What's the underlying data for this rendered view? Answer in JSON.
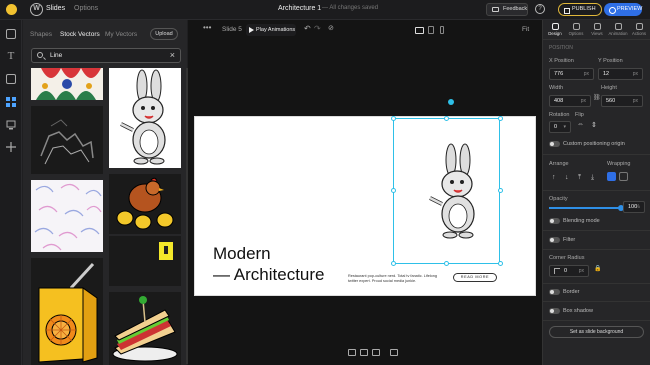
{
  "topbar": {
    "tabs": [
      {
        "label": "Slides"
      },
      {
        "label": "Options"
      }
    ],
    "title": "Architecture 1",
    "status": "— All changes saved",
    "feedback": "Feedback",
    "help": "?",
    "publish": "PUBLISH",
    "preview": "PREVIEW"
  },
  "assets": {
    "tabs": [
      {
        "label": "Shapes"
      },
      {
        "label": "Stock Vectors"
      },
      {
        "label": "My Vectors"
      }
    ],
    "upload": "Upload",
    "search": {
      "value": "Line"
    }
  },
  "canvas": {
    "slide_label": "Slide 5",
    "play_label": "Play Animations",
    "fit_label": "Fit",
    "slide": {
      "title_line1": "Modern",
      "title_line2": "— Architecture",
      "body": "Restaurant pop-culture nerd. Total tv fanatic. Lifelong twitter expert. Proud social media junkie.",
      "button": "READ MORE"
    }
  },
  "inspector": {
    "tabs": [
      {
        "label": "Design"
      },
      {
        "label": "Options"
      },
      {
        "label": "Views"
      },
      {
        "label": "Animation"
      },
      {
        "label": "Actions"
      }
    ],
    "section": "POSITION",
    "x_label": "X Position",
    "x_value": "776",
    "x_unit": "px",
    "y_label": "Y Position",
    "y_value": "12",
    "y_unit": "px",
    "width_label": "Width",
    "width_value": "408",
    "width_unit": "px",
    "height_label": "Height",
    "height_value": "560",
    "height_unit": "px",
    "rotation_label": "Rotation",
    "rotation_value": "0",
    "flip_label": "Flip",
    "custom_pos": "Custom positioning origin",
    "arrange_label": "Arrange",
    "wrapping_label": "Wrapping",
    "opacity_label": "Opacity",
    "opacity_value": "100",
    "opacity_unit": "%",
    "opacity_level": 1.0,
    "blend": "Blending mode",
    "filter": "Filter",
    "corner_label": "Corner Radius",
    "corner_value": "0",
    "corner_unit": "px",
    "border": "Border",
    "shadow": "Box shadow",
    "set_bg": "Set as slide background"
  },
  "colors": {
    "accent": "#2f6fe6",
    "selection": "#2ec0e8",
    "publish": "#e0b73a",
    "logo": "#f2c230"
  }
}
